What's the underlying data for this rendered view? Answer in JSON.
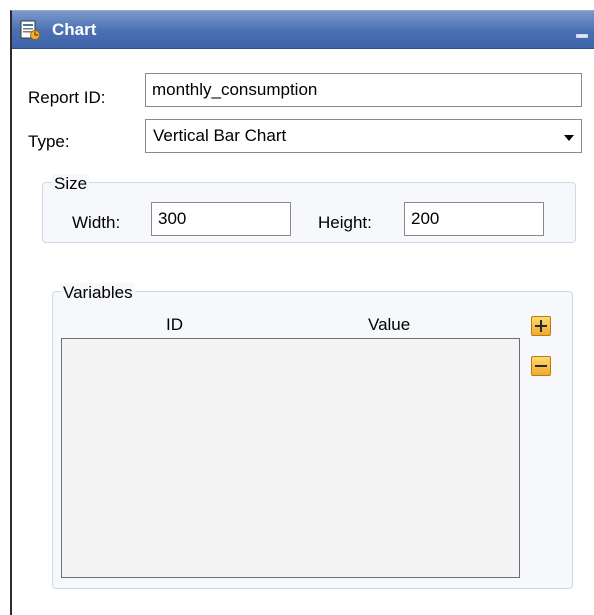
{
  "panel": {
    "title": "Chart",
    "icon": "report-chart-icon"
  },
  "form": {
    "report_id_label": "Report ID:",
    "report_id_value": "monthly_consumption",
    "type_label": "Type:",
    "type_value": "Vertical Bar Chart"
  },
  "size": {
    "legend": "Size",
    "width_label": "Width:",
    "width_value": "300",
    "height_label": "Height:",
    "height_value": "200"
  },
  "variables": {
    "legend": "Variables",
    "columns": [
      "ID",
      "Value"
    ],
    "rows": [],
    "add_icon": "plus-icon",
    "remove_icon": "minus-icon"
  },
  "colors": {
    "titlebar": "#4a6fb2",
    "button_accent": "#f0a92a"
  }
}
